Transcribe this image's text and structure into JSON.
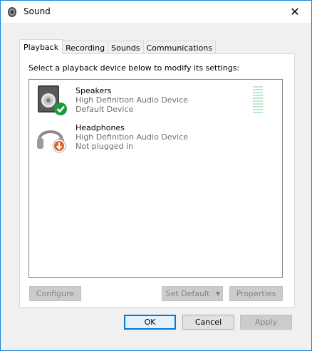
{
  "window": {
    "title": "Sound",
    "close_glyph": "✕",
    "accent": "#1883d7"
  },
  "tabs": [
    {
      "label": "Playback",
      "active": true
    },
    {
      "label": "Recording",
      "active": false
    },
    {
      "label": "Sounds",
      "active": false
    },
    {
      "label": "Communications",
      "active": false
    }
  ],
  "panel": {
    "instruction": "Select a playback device below to modify its settings:"
  },
  "devices": [
    {
      "name": "Speakers",
      "description": "High Definition Audio Device",
      "status": "Default Device",
      "icon": "speaker-icon",
      "badge": "green-check-badge"
    },
    {
      "name": "Headphones",
      "description": "High Definition Audio Device",
      "status": "Not plugged in",
      "icon": "headphones-icon",
      "badge": "orange-down-arrow-badge"
    }
  ],
  "panel_buttons": {
    "configure": "Configure",
    "set_default": "Set Default",
    "set_default_arrow": "▼",
    "properties": "Properties"
  },
  "dialog_buttons": {
    "ok": "OK",
    "cancel": "Cancel",
    "apply": "Apply"
  }
}
